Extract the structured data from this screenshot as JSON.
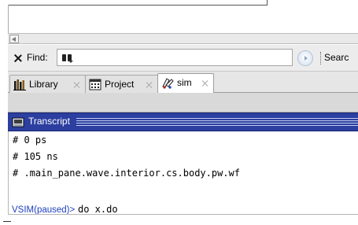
{
  "find_bar": {
    "label": "Find:",
    "value": "",
    "search_label": "Searc"
  },
  "tabs": [
    {
      "label": "Library",
      "active": false,
      "icon": "library-icon"
    },
    {
      "label": "Project",
      "active": false,
      "icon": "project-icon"
    },
    {
      "label": "sim",
      "active": true,
      "icon": "sim-icon"
    }
  ],
  "transcript": {
    "title": "Transcript",
    "lines": [
      "# 0 ps",
      "# 105 ns",
      "# .main_pane.wave.interior.cs.body.pw.wf"
    ],
    "prompt": "VSIM(paused)>",
    "command": "do x.do"
  },
  "colors": {
    "titlebar": "#2c3fa0",
    "prompt": "#1d3fbf"
  }
}
